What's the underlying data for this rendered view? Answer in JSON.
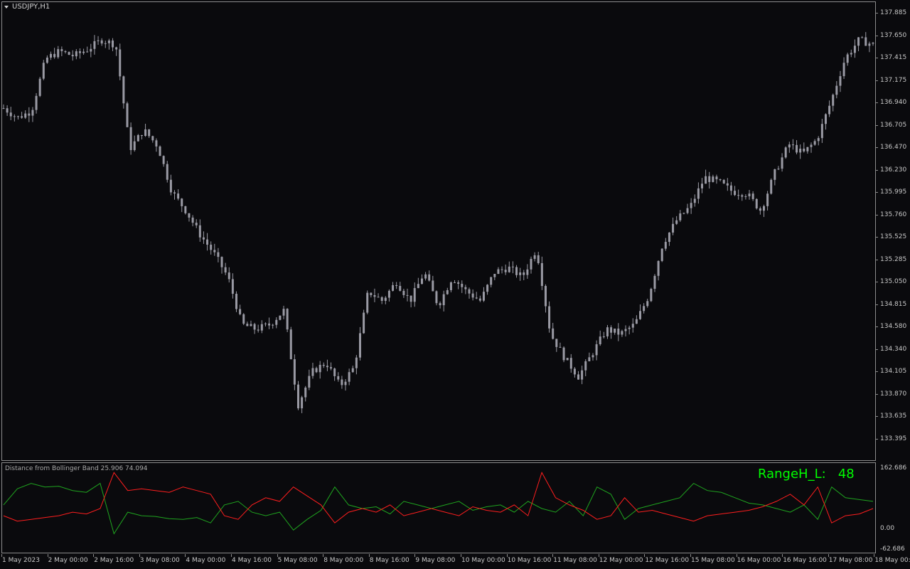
{
  "chart": {
    "symbol_title": "USDJPY,H1",
    "indicator_title": "Distance from Bollinger Band 25.906 74.094",
    "range_label": "RangeH_L:",
    "range_value": "48"
  },
  "colors": {
    "background": "#0a0a0d",
    "candles": "#9a9aa4",
    "frame": "#8c8c8c",
    "line_green": "#1fa51f",
    "line_red": "#ff1e1e",
    "range_text": "#00ff00"
  },
  "price_axis": [
    "137.885",
    "137.650",
    "137.415",
    "137.175",
    "136.940",
    "136.705",
    "136.470",
    "136.230",
    "135.995",
    "135.760",
    "135.525",
    "135.285",
    "135.050",
    "134.815",
    "134.580",
    "134.340",
    "134.105",
    "133.870",
    "133.635",
    "133.395"
  ],
  "indicator_axis": [
    "162.686",
    "0.00",
    "-62.686"
  ],
  "time_axis": [
    "1 May 2023",
    "2 May 00:00",
    "2 May 16:00",
    "3 May 08:00",
    "4 May 00:00",
    "4 May 16:00",
    "5 May 08:00",
    "8 May 00:00",
    "8 May 16:00",
    "9 May 08:00",
    "10 May 00:00",
    "10 May 16:00",
    "11 May 08:00",
    "12 May 00:00",
    "12 May 16:00",
    "15 May 08:00",
    "16 May 00:00",
    "16 May 16:00",
    "17 May 08:00",
    "18 May 00:00"
  ],
  "chart_data": [
    {
      "type": "candlestick",
      "title": "USDJPY,H1",
      "ylim": [
        133.395,
        137.885
      ],
      "x_labels": [
        "1 May 2023",
        "2 May 00:00",
        "2 May 16:00",
        "3 May 08:00",
        "4 May 00:00",
        "4 May 16:00",
        "5 May 08:00",
        "8 May 00:00",
        "8 May 16:00",
        "9 May 08:00",
        "10 May 00:00",
        "10 May 16:00",
        "11 May 08:00",
        "12 May 00:00",
        "12 May 16:00",
        "15 May 08:00",
        "16 May 00:00",
        "16 May 16:00",
        "17 May 08:00",
        "18 May 00:00"
      ],
      "close_path": [
        136.88,
        136.78,
        136.85,
        137.4,
        137.48,
        137.43,
        137.5,
        137.6,
        137.55,
        136.45,
        136.65,
        136.48,
        136.0,
        135.8,
        135.55,
        135.35,
        135.1,
        134.6,
        134.55,
        134.6,
        134.75,
        133.75,
        134.1,
        134.2,
        133.95,
        134.15,
        134.95,
        134.85,
        135.05,
        134.85,
        135.15,
        134.8,
        135.1,
        134.95,
        134.85,
        135.15,
        135.2,
        135.1,
        135.4,
        134.5,
        134.25,
        134.05,
        134.3,
        134.55,
        134.5,
        134.6,
        134.9,
        135.45,
        135.7,
        135.85,
        136.15,
        136.1,
        136.0,
        135.98,
        135.8,
        136.2,
        136.5,
        136.4,
        136.55,
        136.95,
        137.4,
        137.6,
        137.55
      ]
    },
    {
      "type": "line",
      "title": "Distance from Bollinger Band 25.906 74.094",
      "ylim": [
        -62.686,
        162.686
      ],
      "series": [
        {
          "name": "",
          "color": "#1fa51f",
          "values": [
            60,
            105,
            120,
            110,
            112,
            100,
            95,
            120,
            -20,
            40,
            30,
            28,
            22,
            20,
            25,
            10,
            60,
            70,
            40,
            30,
            40,
            -10,
            20,
            45,
            110,
            60,
            50,
            55,
            35,
            70,
            60,
            50,
            60,
            70,
            45,
            55,
            60,
            40,
            70,
            50,
            40,
            70,
            30,
            110,
            90,
            20,
            50,
            60,
            70,
            80,
            120,
            100,
            95,
            80,
            65,
            60,
            50,
            40,
            60,
            20,
            110,
            80,
            75,
            70
          ]
        },
        {
          "name": "",
          "color": "#ff1e1e",
          "values": [
            30,
            15,
            20,
            25,
            30,
            40,
            35,
            50,
            150,
            100,
            105,
            100,
            95,
            110,
            100,
            90,
            30,
            20,
            60,
            80,
            70,
            110,
            85,
            60,
            10,
            40,
            50,
            40,
            60,
            30,
            40,
            50,
            40,
            30,
            55,
            45,
            40,
            60,
            30,
            150,
            80,
            60,
            45,
            20,
            30,
            80,
            40,
            45,
            35,
            25,
            15,
            30,
            35,
            40,
            45,
            55,
            70,
            90,
            60,
            110,
            10,
            30,
            35,
            50
          ]
        }
      ]
    }
  ]
}
